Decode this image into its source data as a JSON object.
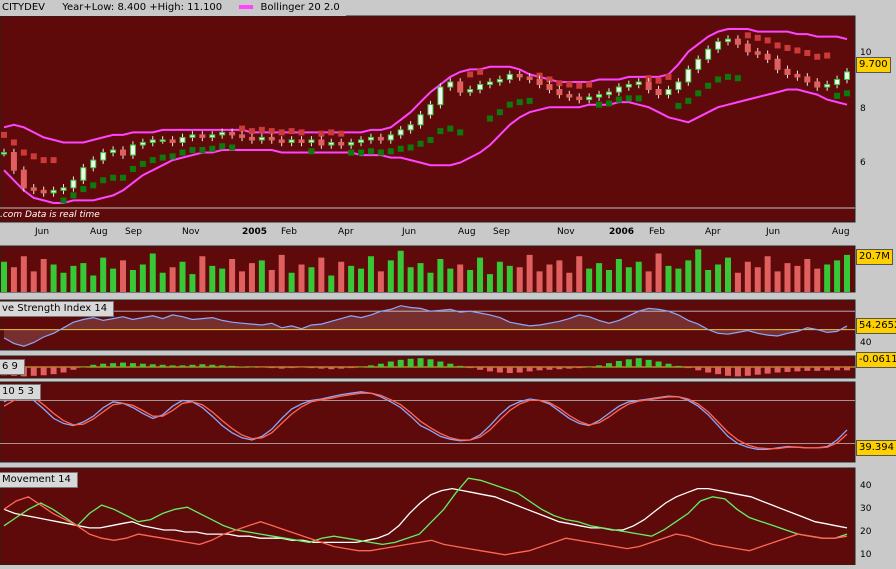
{
  "header": {
    "symbol": "CITYDEV",
    "range": "Year+Low: 8.400 +High: 11.100",
    "indicator": "Bollinger 20 2.0"
  },
  "note": ".com  Data is real time",
  "colors": {
    "bg": "#5e0a0a",
    "up": "#37c837",
    "down": "#e06060",
    "band": "#ff44ff",
    "sar_up": "#0e7a0e",
    "sar_down": "#cc3a3a",
    "line_white": "#ffffff",
    "line_green": "#66ee66",
    "line_red": "#ff6655",
    "line_blue": "#8aa8ff",
    "ref": "#e8c030"
  },
  "x_labels": [
    {
      "label": "Jun",
      "bold": false
    },
    {
      "label": "Aug",
      "bold": false
    },
    {
      "label": "Sep",
      "bold": false
    },
    {
      "label": "Nov",
      "bold": false
    },
    {
      "label": "2005",
      "bold": true
    },
    {
      "label": "Feb",
      "bold": false
    },
    {
      "label": "Apr",
      "bold": false
    },
    {
      "label": "Jun",
      "bold": false
    },
    {
      "label": "Aug",
      "bold": false
    },
    {
      "label": "Sep",
      "bold": false
    },
    {
      "label": "Nov",
      "bold": false
    },
    {
      "label": "2006",
      "bold": true
    },
    {
      "label": "Feb",
      "bold": false
    },
    {
      "label": "Apr",
      "bold": false
    },
    {
      "label": "Jun",
      "bold": false
    },
    {
      "label": "Aug",
      "bold": false
    }
  ],
  "panels": {
    "price": {
      "y_ticks": [
        "10",
        "8",
        "6"
      ],
      "last": "9.700"
    },
    "volume": {
      "last": "20.7M"
    },
    "rsi": {
      "label": "ve Strength Index 14",
      "y_ticks": [
        "40"
      ],
      "last": "54.2652"
    },
    "macd": {
      "label": "6 9",
      "last": "-0.0611"
    },
    "stoch": {
      "label": "10 5 3",
      "last": "39.394"
    },
    "dmi": {
      "label": "Movement 14",
      "y_ticks": [
        "40",
        "30",
        "20",
        "10"
      ]
    }
  },
  "chart_data": {
    "type": "line",
    "x_axis": "weekly, Jun 2004 – Aug 2006",
    "price": {
      "type": "candlestick",
      "ylim": [
        4.3,
        11.6
      ],
      "close": [
        6.5,
        5.8,
        5.1,
        5.0,
        4.9,
        5.0,
        5.1,
        5.4,
        5.9,
        6.2,
        6.5,
        6.6,
        6.4,
        6.8,
        6.9,
        7.0,
        7.0,
        6.9,
        7.1,
        7.2,
        7.1,
        7.2,
        7.3,
        7.2,
        7.1,
        7.0,
        7.1,
        7.0,
        6.9,
        7.0,
        6.9,
        7.0,
        6.8,
        6.9,
        6.8,
        6.9,
        7.0,
        7.1,
        7.0,
        7.2,
        7.4,
        7.6,
        8.0,
        8.4,
        9.1,
        9.3,
        8.9,
        9.0,
        9.2,
        9.3,
        9.4,
        9.6,
        9.5,
        9.4,
        9.2,
        9.0,
        8.8,
        8.7,
        8.6,
        8.7,
        8.8,
        8.9,
        9.1,
        9.2,
        9.3,
        9.0,
        8.8,
        9.0,
        9.3,
        9.8,
        10.2,
        10.6,
        10.9,
        11.0,
        10.8,
        10.5,
        10.4,
        10.2,
        9.8,
        9.6,
        9.5,
        9.3,
        9.1,
        9.2,
        9.4,
        9.7
      ],
      "bollinger_upper": [
        7.5,
        7.6,
        7.5,
        7.3,
        7.1,
        7.0,
        6.9,
        6.9,
        6.9,
        7.0,
        7.1,
        7.2,
        7.2,
        7.3,
        7.3,
        7.3,
        7.4,
        7.4,
        7.4,
        7.4,
        7.4,
        7.4,
        7.4,
        7.4,
        7.4,
        7.3,
        7.3,
        7.3,
        7.3,
        7.3,
        7.3,
        7.3,
        7.3,
        7.3,
        7.3,
        7.3,
        7.3,
        7.4,
        7.4,
        7.5,
        7.8,
        8.1,
        8.5,
        8.9,
        9.2,
        9.5,
        9.7,
        9.8,
        9.8,
        9.9,
        9.9,
        9.9,
        9.8,
        9.6,
        9.5,
        9.4,
        9.3,
        9.3,
        9.3,
        9.3,
        9.4,
        9.4,
        9.4,
        9.5,
        9.5,
        9.5,
        9.5,
        9.6,
        10.0,
        10.5,
        10.8,
        11.1,
        11.3,
        11.4,
        11.4,
        11.4,
        11.3,
        11.3,
        11.3,
        11.3,
        11.2,
        11.2,
        11.1,
        11.1,
        11.1,
        11.0
      ],
      "bollinger_lower": [
        5.8,
        5.4,
        5.0,
        4.7,
        4.6,
        4.5,
        4.5,
        4.6,
        4.6,
        4.6,
        4.7,
        4.8,
        5.0,
        5.3,
        5.6,
        5.8,
        6.0,
        6.2,
        6.3,
        6.4,
        6.5,
        6.5,
        6.6,
        6.6,
        6.6,
        6.6,
        6.6,
        6.6,
        6.5,
        6.5,
        6.5,
        6.5,
        6.5,
        6.5,
        6.5,
        6.5,
        6.4,
        6.4,
        6.4,
        6.3,
        6.3,
        6.2,
        6.1,
        6.0,
        6.0,
        6.0,
        6.1,
        6.3,
        6.5,
        6.8,
        7.2,
        7.6,
        7.9,
        8.1,
        8.2,
        8.3,
        8.3,
        8.3,
        8.3,
        8.4,
        8.4,
        8.4,
        8.5,
        8.5,
        8.4,
        8.3,
        8.1,
        7.9,
        7.8,
        7.7,
        7.9,
        8.1,
        8.3,
        8.4,
        8.5,
        8.6,
        8.7,
        8.8,
        8.9,
        9.0,
        9.0,
        8.9,
        8.8,
        8.6,
        8.5,
        8.4
      ]
    },
    "volume": {
      "type": "bar",
      "unit": "M",
      "values": [
        22,
        18,
        26,
        15,
        24,
        20,
        14,
        19,
        21,
        12,
        25,
        17,
        23,
        16,
        20,
        28,
        14,
        18,
        22,
        13,
        26,
        19,
        17,
        24,
        15,
        21,
        23,
        16,
        27,
        14,
        20,
        18,
        25,
        12,
        22,
        19,
        17,
        26,
        15,
        23,
        30,
        18,
        21,
        14,
        24,
        17,
        20,
        16,
        25,
        13,
        22,
        19,
        18,
        27,
        15,
        20,
        23,
        14,
        26,
        17,
        21,
        16,
        24,
        18,
        22,
        15,
        28,
        19,
        17,
        23,
        31,
        16,
        20,
        25,
        14,
        22,
        18,
        26,
        15,
        21,
        19,
        24,
        17,
        20,
        23,
        27
      ]
    },
    "rsi": {
      "period": 14,
      "ylim": [
        30,
        80
      ],
      "reference": 50,
      "values": [
        41,
        35,
        32,
        36,
        42,
        46,
        52,
        58,
        61,
        63,
        60,
        62,
        64,
        61,
        63,
        65,
        62,
        66,
        64,
        61,
        62,
        63,
        60,
        58,
        57,
        56,
        55,
        57,
        52,
        54,
        51,
        55,
        56,
        59,
        62,
        65,
        63,
        66,
        70,
        72,
        76,
        74,
        73,
        70,
        71,
        72,
        69,
        70,
        68,
        66,
        63,
        58,
        56,
        54,
        55,
        57,
        59,
        62,
        66,
        64,
        60,
        57,
        60,
        65,
        70,
        73,
        72,
        70,
        66,
        60,
        56,
        50,
        46,
        45,
        47,
        49,
        46,
        44,
        43,
        46,
        48,
        52,
        50,
        47,
        48,
        54
      ]
    },
    "macd": {
      "params": "6 9",
      "ylim": [
        -0.2,
        0.2
      ],
      "values": [
        -0.15,
        -0.16,
        -0.17,
        -0.16,
        -0.15,
        -0.13,
        -0.1,
        -0.05,
        0,
        0.04,
        0.06,
        0.07,
        0.08,
        0.07,
        0.06,
        0.05,
        0.04,
        0.03,
        0.03,
        0.04,
        0.05,
        0.04,
        0.03,
        0.02,
        0.01,
        0,
        -0.01,
        -0.02,
        -0.03,
        -0.02,
        -0.01,
        -0.02,
        -0.03,
        -0.04,
        -0.03,
        -0.02,
        0,
        0.03,
        0.06,
        0.1,
        0.13,
        0.15,
        0.16,
        0.14,
        0.1,
        0.06,
        0.02,
        -0.02,
        -0.05,
        -0.08,
        -0.1,
        -0.11,
        -0.1,
        -0.08,
        -0.06,
        -0.05,
        -0.04,
        -0.03,
        -0.02,
        0,
        0.03,
        0.07,
        0.11,
        0.14,
        0.16,
        0.13,
        0.1,
        0.06,
        0.02,
        -0.02,
        -0.06,
        -0.1,
        -0.13,
        -0.16,
        -0.17,
        -0.16,
        -0.14,
        -0.12,
        -0.1,
        -0.09,
        -0.08,
        -0.07,
        -0.07,
        -0.06,
        -0.06,
        -0.06
      ]
    },
    "stochastic": {
      "params": "10 5 3",
      "ylim": [
        0,
        100
      ],
      "series": [
        {
          "values": [
            78,
            85,
            88,
            80,
            68,
            55,
            48,
            45,
            50,
            58,
            70,
            78,
            76,
            70,
            62,
            55,
            60,
            72,
            80,
            78,
            70,
            58,
            45,
            35,
            28,
            25,
            30,
            40,
            55,
            68,
            75,
            80,
            82,
            85,
            88,
            90,
            92,
            90,
            85,
            78,
            70,
            58,
            45,
            38,
            30,
            26,
            24,
            25,
            32,
            45,
            60,
            72,
            78,
            82,
            80,
            75,
            65,
            55,
            48,
            45,
            52,
            62,
            72,
            78,
            80,
            82,
            84,
            86,
            85,
            80,
            72,
            60,
            45,
            30,
            20,
            15,
            12,
            12,
            14,
            16,
            15,
            14,
            14,
            16,
            25,
            39
          ]
        },
        {
          "values": [
            72,
            80,
            86,
            84,
            74,
            62,
            52,
            46,
            47,
            54,
            64,
            74,
            76,
            73,
            66,
            58,
            58,
            66,
            76,
            78,
            74,
            64,
            52,
            41,
            32,
            27,
            28,
            35,
            48,
            61,
            71,
            78,
            81,
            83,
            86,
            88,
            90,
            90,
            87,
            81,
            74,
            63,
            51,
            42,
            34,
            28,
            25,
            25,
            29,
            39,
            53,
            66,
            75,
            80,
            80,
            77,
            69,
            59,
            51,
            46,
            49,
            57,
            67,
            75,
            79,
            81,
            83,
            85,
            85,
            82,
            75,
            64,
            50,
            36,
            25,
            18,
            14,
            13,
            13,
            15,
            15,
            14,
            14,
            15,
            21,
            33
          ]
        }
      ]
    },
    "dmi": {
      "period": 14,
      "ylim": [
        5,
        48
      ],
      "series": [
        {
          "values": [
            30,
            28,
            27,
            26,
            25,
            24,
            23,
            22,
            21,
            21,
            22,
            23,
            24,
            22,
            21,
            20,
            20,
            19,
            19,
            18,
            18,
            18,
            17,
            17,
            16,
            16,
            16,
            15,
            15,
            14,
            14,
            14,
            14,
            14,
            15,
            16,
            18,
            22,
            28,
            33,
            37,
            39,
            40,
            39,
            38,
            37,
            36,
            34,
            32,
            30,
            28,
            26,
            24,
            23,
            22,
            21,
            21,
            20,
            20,
            22,
            25,
            29,
            33,
            36,
            38,
            40,
            40,
            39,
            38,
            37,
            36,
            34,
            32,
            30,
            28,
            26,
            24,
            23,
            22,
            21
          ]
        },
        {
          "values": [
            22,
            26,
            30,
            33,
            30,
            26,
            22,
            28,
            32,
            30,
            27,
            24,
            25,
            28,
            30,
            31,
            28,
            25,
            22,
            20,
            19,
            18,
            17,
            16,
            15,
            14,
            16,
            17,
            16,
            15,
            14,
            13,
            14,
            16,
            18,
            24,
            30,
            38,
            45,
            44,
            42,
            40,
            38,
            34,
            30,
            27,
            25,
            24,
            22,
            21,
            20,
            19,
            18,
            17,
            20,
            24,
            28,
            34,
            36,
            35,
            30,
            26,
            24,
            22,
            20,
            18,
            17,
            16,
            16,
            18
          ]
        },
        {
          "values": [
            30,
            34,
            36,
            32,
            28,
            25,
            22,
            18,
            16,
            15,
            16,
            18,
            17,
            16,
            15,
            14,
            13,
            15,
            18,
            20,
            22,
            24,
            22,
            20,
            18,
            16,
            14,
            12,
            11,
            10,
            10,
            11,
            12,
            13,
            14,
            15,
            13,
            12,
            11,
            10,
            9,
            8,
            9,
            10,
            12,
            14,
            16,
            15,
            14,
            13,
            12,
            11,
            12,
            14,
            16,
            18,
            17,
            15,
            13,
            12,
            11,
            10,
            12,
            14,
            16,
            18,
            17,
            16,
            16,
            17
          ]
        }
      ]
    }
  }
}
